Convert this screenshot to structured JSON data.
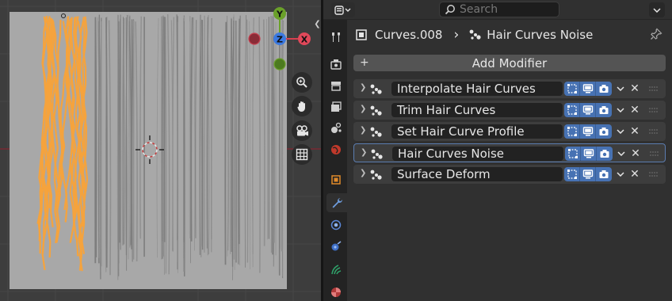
{
  "viewport": {
    "gizmo": {
      "axis_y": "Y",
      "axis_z": "Z",
      "axis_x": "X"
    },
    "nav_tools": [
      "zoom-icon",
      "hand-pan-icon",
      "camera-view-icon",
      "grid-ortho-icon"
    ],
    "colors": {
      "background": "#3d3d3d",
      "selected_curves": "#f5a33d",
      "plane": "#a8a8a8",
      "axis_red": "#a3303f",
      "axis_green": "#5c8a2a",
      "axis_blue": "#2f6fd6"
    }
  },
  "properties": {
    "search": {
      "placeholder": "Search"
    },
    "breadcrumb": {
      "object": "Curves.008",
      "separator": "›",
      "modifier": "Hair Curves Noise"
    },
    "add_modifier": {
      "plus": "+",
      "label": "Add Modifier"
    },
    "tabs": [
      "tool-icon",
      "render-icon",
      "output-icon",
      "view-layer-icon",
      "scene-icon",
      "world-icon",
      "object-icon",
      "modifier-icon",
      "particles-icon",
      "physics-icon",
      "object-data-hair-icon",
      "material-icon"
    ],
    "active_tab": "modifier-icon",
    "modifiers": [
      {
        "name": "Interpolate Hair Curves",
        "active": false
      },
      {
        "name": "Trim Hair Curves",
        "active": false
      },
      {
        "name": "Set Hair Curve Profile",
        "active": false
      },
      {
        "name": "Hair Curves Noise",
        "active": true
      },
      {
        "name": "Surface Deform",
        "active": false
      }
    ],
    "remove_label": "✕",
    "accent": "#4772b3"
  }
}
